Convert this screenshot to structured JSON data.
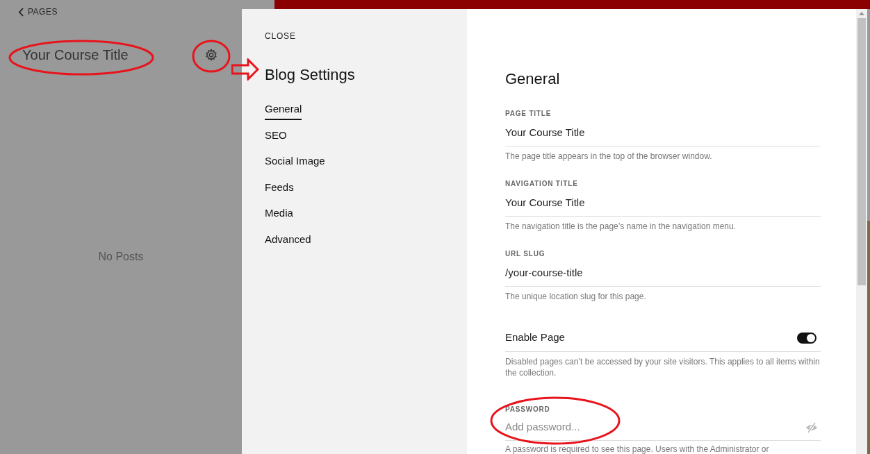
{
  "back_link": "PAGES",
  "page_title": "Your Course Title",
  "empty_message": "No Posts",
  "settings_panel": {
    "close": "CLOSE",
    "title": "Blog Settings",
    "nav": [
      {
        "label": "General",
        "selected": true
      },
      {
        "label": "SEO",
        "selected": false
      },
      {
        "label": "Social Image",
        "selected": false
      },
      {
        "label": "Feeds",
        "selected": false
      },
      {
        "label": "Media",
        "selected": false
      },
      {
        "label": "Advanced",
        "selected": false
      }
    ]
  },
  "section_title": "General",
  "fields": [
    {
      "kind": "text",
      "label": "PAGE TITLE",
      "value": "Your Course Title",
      "help": "The page title appears in the top of the browser window."
    },
    {
      "kind": "text",
      "label": "NAVIGATION TITLE",
      "value": "Your Course Title",
      "help": "The navigation title is the page’s name in the navigation menu."
    },
    {
      "kind": "text",
      "label": "URL SLUG",
      "value": "/your-course-title",
      "help": "The unique location slug for this page."
    },
    {
      "kind": "toggle",
      "label": "Enable Page",
      "on": true,
      "help": "Disabled pages can’t be accessed by your site visitors. This applies to all items within the collection."
    },
    {
      "kind": "password",
      "label": "PASSWORD",
      "placeholder": "Add password...",
      "help": "A password is required to see this page. Users with the Administrator or"
    }
  ]
}
